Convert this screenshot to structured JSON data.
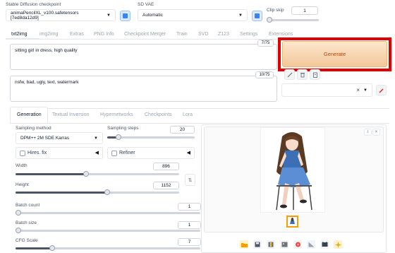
{
  "top": {
    "checkpoint_label": "Stable Diffusion checkpoint",
    "checkpoint_value": "animaPencilXL_v100.safetensors [7ed8da12d9]",
    "vae_label": "SD VAE",
    "vae_value": "Automatic",
    "clip_label": "Clip skip",
    "clip_value": "1",
    "clip_level": 0.0
  },
  "tabs": [
    "txt2img",
    "img2img",
    "Extras",
    "PNG Info",
    "Checkpoint Merger",
    "Train",
    "SVD",
    "Z123",
    "Settings",
    "Extensions"
  ],
  "prompt": {
    "text": "sitting girl in dress, high quality",
    "counter": "7/75"
  },
  "negative": {
    "text": "nsfw, bad, ugly, text, watermark",
    "counter": "10/75"
  },
  "generate_label": "Generate",
  "styles_clear": "×",
  "subtabs": [
    "Generation",
    "Textual Inversion",
    "Hypernetworks",
    "Checkpoints",
    "Lora"
  ],
  "sampling": {
    "method_label": "Sampling method",
    "method_value": "DPM++ 2M SDE Karras",
    "steps_label": "Sampling steps",
    "steps_value": "20",
    "steps_level": 0.13
  },
  "hires_label": "Hires. fix",
  "refiner_label": "Refiner",
  "width": {
    "label": "Width",
    "value": "896",
    "level": 0.43
  },
  "height": {
    "label": "Height",
    "value": "1152",
    "level": 0.56
  },
  "batch_count": {
    "label": "Batch count",
    "value": "1",
    "level": 0.0
  },
  "batch_size": {
    "label": "Batch size",
    "value": "1",
    "level": 0.0
  },
  "cfg": {
    "label": "CFG Scale",
    "value": "7",
    "level": 0.2
  },
  "colors": {
    "accent_orange": "#f59e0b",
    "generate_gradient_from": "#fde7cc",
    "generate_gradient_to": "#f2c79a",
    "highlight_red": "#e00000",
    "blue_button": "#3b82f6"
  },
  "icons": {
    "swap": "⇅",
    "output_tools": [
      "folder-icon",
      "save-icon",
      "zip-icon",
      "send-img2img-icon",
      "send-inpaint-icon",
      "send-extras-icon",
      "video-icon",
      "spark-icon"
    ]
  }
}
